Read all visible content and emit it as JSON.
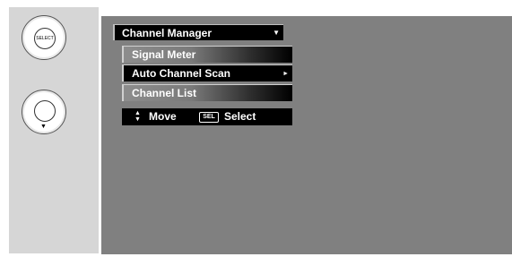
{
  "remote": {
    "select_button_label": "SELECT",
    "nav_arrow": "▼"
  },
  "menu": {
    "title": "Channel Manager",
    "title_arrow": "▼",
    "items": [
      {
        "label": "Signal Meter",
        "state": "dim"
      },
      {
        "label": "Auto Channel Scan",
        "state": "highlighted",
        "arrow": "►"
      },
      {
        "label": "Channel List",
        "state": "dim"
      }
    ]
  },
  "help": {
    "move_icon": "▲▼►",
    "move_label": "Move",
    "select_key": "SEL",
    "select_label": "Select"
  },
  "colors": {
    "screen_bg": "#808080",
    "panel_bg": "#d6d6d6",
    "highlight_bg": "#000000",
    "text": "#ffffff"
  }
}
